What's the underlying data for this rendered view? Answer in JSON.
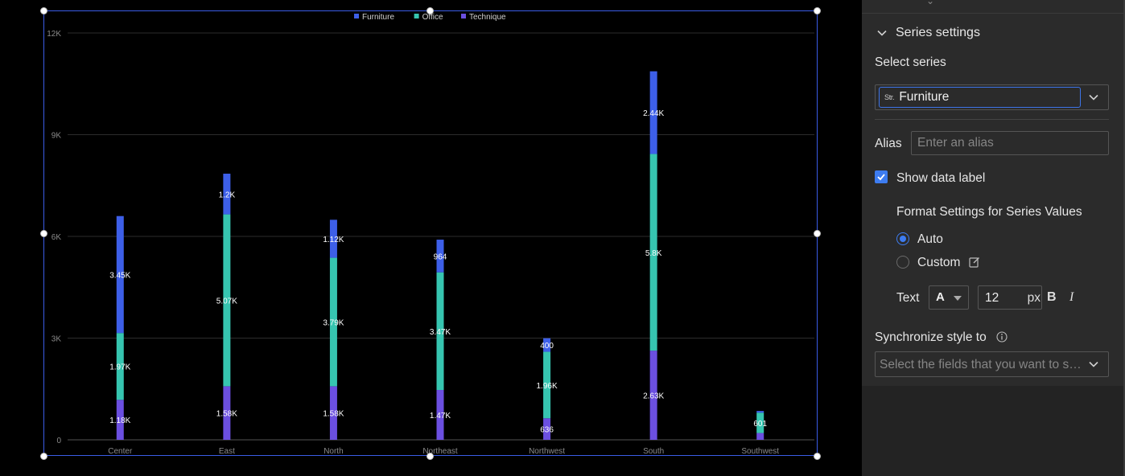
{
  "chart_data": {
    "type": "bar",
    "stacked": true,
    "categories": [
      "Center",
      "East",
      "North",
      "Northeast",
      "Northwest",
      "South",
      "Southwest"
    ],
    "series": [
      {
        "name": "Technique",
        "color": "#6b4fe0",
        "values": [
          1180,
          1580,
          1580,
          1470,
          636,
          2630,
          200
        ],
        "labels": [
          "1.18K",
          "1.58K",
          "1.58K",
          "1.47K",
          "636",
          "2.63K",
          ""
        ]
      },
      {
        "name": "Office",
        "color": "#36c5b0",
        "values": [
          1970,
          5070,
          3790,
          3470,
          1960,
          5800,
          601
        ],
        "labels": [
          "1.97K",
          "5.07K",
          "3.79K",
          "3.47K",
          "1.96K",
          "5.8K",
          "601"
        ]
      },
      {
        "name": "Furniture",
        "color": "#3d5fe8",
        "values": [
          3450,
          1200,
          1120,
          964,
          400,
          2440,
          50
        ],
        "labels": [
          "3.45K",
          "1.2K",
          "1.12K",
          "964",
          "400",
          "2.44K",
          ""
        ]
      }
    ],
    "legend_order": [
      "Furniture",
      "Office",
      "Technique"
    ],
    "yticks": [
      0,
      3000,
      6000,
      9000,
      12000
    ],
    "yticklabels": [
      "0",
      "3K",
      "6K",
      "9K",
      "12K"
    ],
    "ylim": [
      0,
      12000
    ],
    "grid": true,
    "legend_position": "top"
  },
  "panel": {
    "section_title": "Series settings",
    "select_series_label": "Select series",
    "series_type_tag": "Str.",
    "selected_series": "Furniture",
    "alias_label": "Alias",
    "alias_placeholder": "Enter an alias",
    "show_data_label": "Show data label",
    "show_data_label_checked": true,
    "format_title": "Format Settings for Series Values",
    "radio_auto": "Auto",
    "radio_custom": "Custom",
    "format_selected": "Auto",
    "text_label": "Text",
    "font_glyph": "A",
    "font_size": "12",
    "font_unit": "px",
    "bold_label": "B",
    "italic_label": "I",
    "sync_label": "Synchronize style to",
    "sync_placeholder": "Select the fields that you want to synchronize"
  }
}
